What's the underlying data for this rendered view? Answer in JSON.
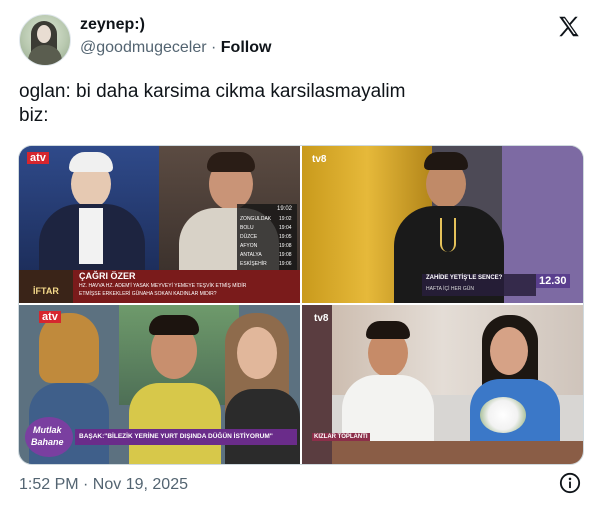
{
  "author": {
    "display_name": "zeynep:)",
    "handle": "@goodmugeceler",
    "separator": " · ",
    "follow_label": "Follow"
  },
  "tweet": {
    "line1": "oglan: bi daha karsima cikma karsilasmayalim",
    "line2": "biz:"
  },
  "media": {
    "panel1": {
      "channel_logo": "atv",
      "name_banner": "ÇAĞRI ÖZER",
      "caption_line1": "HZ. HAVVA HZ. ADEM'İ YASAK MEYVEYİ YEMEYE TEŞVİK ETMİŞ MİDİR",
      "caption_line2": "ETMİŞSE ERKEKLERİ GÜNAHA SOKAN KADINLAR MIDIR?",
      "show_name": "İFTAR",
      "clock": "19:02",
      "side_list": [
        "ZONGULDAK",
        "BOLU",
        "DÜZCE",
        "AFYON",
        "ANTALYA",
        "ESKİŞEHİR"
      ],
      "side_times": [
        "19:02",
        "19:04",
        "19:05",
        "19:08",
        "19:08",
        "19:06"
      ]
    },
    "panel2": {
      "channel_logo": "tv8",
      "show_banner": "ZAHİDE YETİŞ'LE SENCE?",
      "show_sub": "HAFTA İÇİ HER GÜN",
      "clock": "12.30"
    },
    "panel3": {
      "channel_logo": "atv",
      "show_logo_line1": "Mutlak",
      "show_logo_line2": "Bahane",
      "caption": "BAŞAK:\"BİLEZİK YERİNE YURT DIŞINDA DÜĞÜN İSTİYORUM\""
    },
    "panel4": {
      "channel_logo": "tv8",
      "show_logo": "KIZLAR TOPLANTI"
    }
  },
  "footer": {
    "timestamp": "1:52 PM · Nov 19, 2025"
  },
  "colors": {
    "text": "#0f1419",
    "muted": "#536471",
    "border": "#cfd9de"
  }
}
